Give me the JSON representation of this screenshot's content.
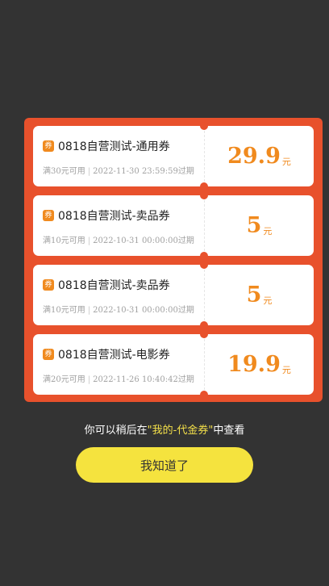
{
  "coupons": [
    {
      "badge": "券",
      "title": "0818自营测试-通用券",
      "condition": "满30元可用",
      "expiry": "2022-11-30 23:59:59过期",
      "amount": "29.9",
      "unit": "元"
    },
    {
      "badge": "券",
      "title": "0818自营测试-卖品券",
      "condition": "满10元可用",
      "expiry": "2022-10-31 00:00:00过期",
      "amount": "5",
      "unit": "元"
    },
    {
      "badge": "券",
      "title": "0818自营测试-卖品券",
      "condition": "满10元可用",
      "expiry": "2022-10-31 00:00:00过期",
      "amount": "5",
      "unit": "元"
    },
    {
      "badge": "券",
      "title": "0818自营测试-电影券",
      "condition": "满20元可用",
      "expiry": "2022-11-26 10:40:42过期",
      "amount": "19.9",
      "unit": "元"
    }
  ],
  "tip": {
    "prefix": "你可以稍后在",
    "highlight": "\"我的-代金券\"",
    "suffix": "中查看"
  },
  "ok_button": "我知道了",
  "colors": {
    "panel": "#e8512c",
    "accent": "#f08a1e",
    "button": "#f5e33e",
    "overlay": "#333333"
  }
}
